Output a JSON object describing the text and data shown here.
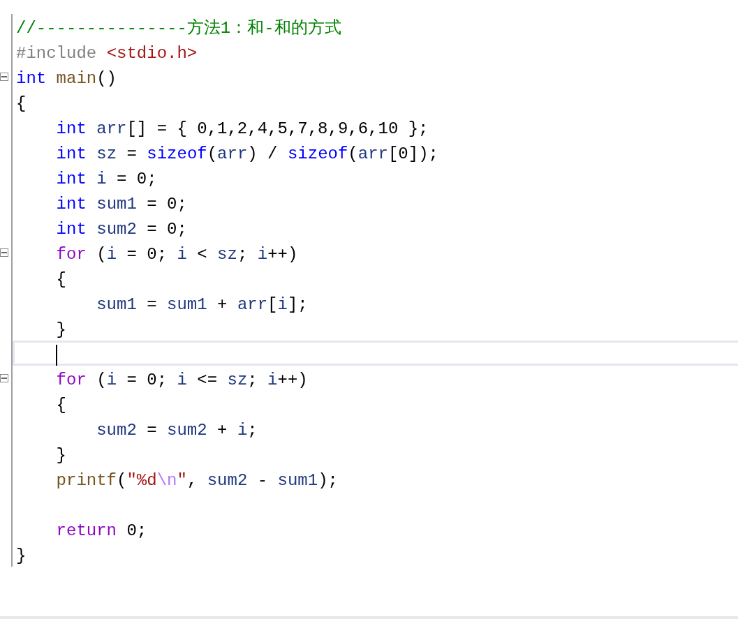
{
  "editor": {
    "lines": [
      {
        "foldable": false,
        "current": false,
        "tokens": [
          {
            "text": "//---------------方法1：和-和的方式",
            "kind": "comment"
          }
        ]
      },
      {
        "foldable": false,
        "current": false,
        "tokens": [
          {
            "text": "#include ",
            "kind": "preprocessor"
          },
          {
            "text": "<stdio.h>",
            "kind": "string"
          }
        ]
      },
      {
        "foldable": true,
        "current": false,
        "tokens": [
          {
            "text": "int ",
            "kind": "type"
          },
          {
            "text": "main",
            "kind": "function"
          },
          {
            "text": "()",
            "kind": "plain"
          }
        ]
      },
      {
        "foldable": false,
        "current": false,
        "tokens": [
          {
            "text": "{",
            "kind": "plain"
          }
        ]
      },
      {
        "foldable": false,
        "current": false,
        "tokens": [
          {
            "text": "    int",
            "kind": "type"
          },
          {
            "text": " arr",
            "kind": "variable"
          },
          {
            "text": "[] = { 0,1,2,4,5,7,8,9,6,10 };",
            "kind": "plain"
          }
        ]
      },
      {
        "foldable": false,
        "current": false,
        "tokens": [
          {
            "text": "    int",
            "kind": "type"
          },
          {
            "text": " sz",
            "kind": "variable"
          },
          {
            "text": " = ",
            "kind": "plain"
          },
          {
            "text": "sizeof",
            "kind": "type"
          },
          {
            "text": "(",
            "kind": "plain"
          },
          {
            "text": "arr",
            "kind": "variable"
          },
          {
            "text": ") / ",
            "kind": "plain"
          },
          {
            "text": "sizeof",
            "kind": "type"
          },
          {
            "text": "(",
            "kind": "plain"
          },
          {
            "text": "arr",
            "kind": "variable"
          },
          {
            "text": "[0]);",
            "kind": "plain"
          }
        ]
      },
      {
        "foldable": false,
        "current": false,
        "tokens": [
          {
            "text": "    int",
            "kind": "type"
          },
          {
            "text": " i",
            "kind": "variable"
          },
          {
            "text": " = 0;",
            "kind": "plain"
          }
        ]
      },
      {
        "foldable": false,
        "current": false,
        "tokens": [
          {
            "text": "    int",
            "kind": "type"
          },
          {
            "text": " sum1",
            "kind": "variable"
          },
          {
            "text": " = 0;",
            "kind": "plain"
          }
        ]
      },
      {
        "foldable": false,
        "current": false,
        "tokens": [
          {
            "text": "    int",
            "kind": "type"
          },
          {
            "text": " sum2",
            "kind": "variable"
          },
          {
            "text": " = 0;",
            "kind": "plain"
          }
        ]
      },
      {
        "foldable": true,
        "current": false,
        "tokens": [
          {
            "text": "    for",
            "kind": "control"
          },
          {
            "text": " (",
            "kind": "plain"
          },
          {
            "text": "i",
            "kind": "variable"
          },
          {
            "text": " = 0; ",
            "kind": "plain"
          },
          {
            "text": "i",
            "kind": "variable"
          },
          {
            "text": " < ",
            "kind": "plain"
          },
          {
            "text": "sz",
            "kind": "variable"
          },
          {
            "text": "; ",
            "kind": "plain"
          },
          {
            "text": "i",
            "kind": "variable"
          },
          {
            "text": "++)",
            "kind": "plain"
          }
        ]
      },
      {
        "foldable": false,
        "current": false,
        "tokens": [
          {
            "text": "    {",
            "kind": "plain"
          }
        ]
      },
      {
        "foldable": false,
        "current": false,
        "tokens": [
          {
            "text": "        sum1",
            "kind": "variable"
          },
          {
            "text": " = ",
            "kind": "plain"
          },
          {
            "text": "sum1",
            "kind": "variable"
          },
          {
            "text": " + ",
            "kind": "plain"
          },
          {
            "text": "arr",
            "kind": "variable"
          },
          {
            "text": "[",
            "kind": "plain"
          },
          {
            "text": "i",
            "kind": "variable"
          },
          {
            "text": "];",
            "kind": "plain"
          }
        ]
      },
      {
        "foldable": false,
        "current": false,
        "tokens": [
          {
            "text": "    }",
            "kind": "plain"
          }
        ]
      },
      {
        "foldable": false,
        "current": true
      },
      {
        "foldable": true,
        "current": false,
        "tokens": [
          {
            "text": "    for",
            "kind": "control"
          },
          {
            "text": " (",
            "kind": "plain"
          },
          {
            "text": "i",
            "kind": "variable"
          },
          {
            "text": " = 0; ",
            "kind": "plain"
          },
          {
            "text": "i",
            "kind": "variable"
          },
          {
            "text": " <= ",
            "kind": "plain"
          },
          {
            "text": "sz",
            "kind": "variable"
          },
          {
            "text": "; ",
            "kind": "plain"
          },
          {
            "text": "i",
            "kind": "variable"
          },
          {
            "text": "++)",
            "kind": "plain"
          }
        ]
      },
      {
        "foldable": false,
        "current": false,
        "tokens": [
          {
            "text": "    {",
            "kind": "plain"
          }
        ]
      },
      {
        "foldable": false,
        "current": false,
        "tokens": [
          {
            "text": "        sum2",
            "kind": "variable"
          },
          {
            "text": " = ",
            "kind": "plain"
          },
          {
            "text": "sum2",
            "kind": "variable"
          },
          {
            "text": " + ",
            "kind": "plain"
          },
          {
            "text": "i",
            "kind": "variable"
          },
          {
            "text": ";",
            "kind": "plain"
          }
        ]
      },
      {
        "foldable": false,
        "current": false,
        "tokens": [
          {
            "text": "    }",
            "kind": "plain"
          }
        ]
      },
      {
        "foldable": false,
        "current": false,
        "tokens": [
          {
            "text": "    printf",
            "kind": "function"
          },
          {
            "text": "(",
            "kind": "plain"
          },
          {
            "text": "\"%d",
            "kind": "string"
          },
          {
            "text": "\\n",
            "kind": "escape"
          },
          {
            "text": "\"",
            "kind": "string"
          },
          {
            "text": ", ",
            "kind": "plain"
          },
          {
            "text": "sum2",
            "kind": "variable"
          },
          {
            "text": " - ",
            "kind": "plain"
          },
          {
            "text": "sum1",
            "kind": "variable"
          },
          {
            "text": ");",
            "kind": "plain"
          }
        ]
      },
      {
        "foldable": false,
        "current": false
      },
      {
        "foldable": false,
        "current": false,
        "tokens": [
          {
            "text": "    return",
            "kind": "control"
          },
          {
            "text": " 0;",
            "kind": "plain"
          }
        ]
      },
      {
        "foldable": false,
        "current": false,
        "tokens": [
          {
            "text": "}",
            "kind": "plain"
          }
        ]
      }
    ]
  }
}
